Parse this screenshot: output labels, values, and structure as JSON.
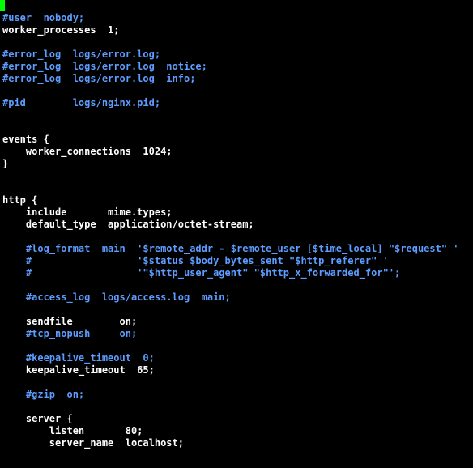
{
  "editor": {
    "filetype": "nginx-config",
    "lines": [
      {
        "t": "#user  nobody;",
        "c": "comment"
      },
      {
        "t": "worker_processes  1;",
        "c": "text"
      },
      {
        "t": "",
        "c": "text"
      },
      {
        "t": "#error_log  logs/error.log;",
        "c": "comment"
      },
      {
        "t": "#error_log  logs/error.log  notice;",
        "c": "comment"
      },
      {
        "t": "#error_log  logs/error.log  info;",
        "c": "comment"
      },
      {
        "t": "",
        "c": "text"
      },
      {
        "t": "#pid        logs/nginx.pid;",
        "c": "comment"
      },
      {
        "t": "",
        "c": "text"
      },
      {
        "t": "",
        "c": "text"
      },
      {
        "t": "events {",
        "c": "text"
      },
      {
        "t": "    worker_connections  1024;",
        "c": "text"
      },
      {
        "t": "}",
        "c": "text"
      },
      {
        "t": "",
        "c": "text"
      },
      {
        "t": "",
        "c": "text"
      },
      {
        "t": "http {",
        "c": "text"
      },
      {
        "t": "    include       mime.types;",
        "c": "text"
      },
      {
        "t": "    default_type  application/octet-stream;",
        "c": "text"
      },
      {
        "t": "",
        "c": "text"
      },
      {
        "t": "    #log_format  main  '$remote_addr - $remote_user [$time_local] \"$request\" '",
        "c": "comment"
      },
      {
        "t": "    #                  '$status $body_bytes_sent \"$http_referer\" '",
        "c": "comment"
      },
      {
        "t": "    #                  '\"$http_user_agent\" \"$http_x_forwarded_for\"';",
        "c": "comment"
      },
      {
        "t": "",
        "c": "text"
      },
      {
        "t": "    #access_log  logs/access.log  main;",
        "c": "comment"
      },
      {
        "t": "",
        "c": "text"
      },
      {
        "t": "    sendfile        on;",
        "c": "text"
      },
      {
        "t": "    #tcp_nopush     on;",
        "c": "comment"
      },
      {
        "t": "",
        "c": "text"
      },
      {
        "t": "    #keepalive_timeout  0;",
        "c": "comment"
      },
      {
        "t": "    keepalive_timeout  65;",
        "c": "text"
      },
      {
        "t": "",
        "c": "text"
      },
      {
        "t": "    #gzip  on;",
        "c": "comment"
      },
      {
        "t": "",
        "c": "text"
      },
      {
        "t": "    server {",
        "c": "text"
      },
      {
        "t": "        listen       80;",
        "c": "text"
      },
      {
        "t": "        server_name  localhost;",
        "c": "text"
      },
      {
        "t": "",
        "c": "text"
      }
    ]
  }
}
